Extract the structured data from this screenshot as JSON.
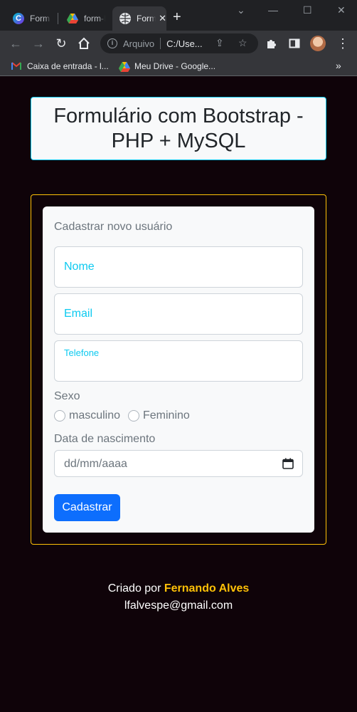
{
  "browser": {
    "tabs": [
      {
        "label": "Form B",
        "icon": "canva-icon"
      },
      {
        "label": "form-L",
        "icon": "google-drive-icon"
      },
      {
        "label": "Form",
        "icon": "globe-icon",
        "active": true
      }
    ],
    "omnibox": {
      "security_label": "Arquivo",
      "url": "C:/Use..."
    },
    "bookmarks": [
      {
        "label": "Caixa de entrada - l...",
        "icon": "gmail-icon"
      },
      {
        "label": "Meu Drive - Google...",
        "icon": "google-drive-icon"
      }
    ],
    "bookmarks_more": "»"
  },
  "page": {
    "title": "Formulário com Bootstrap - PHP + MySQL",
    "form": {
      "legend": "Cadastrar novo usuário",
      "fields": {
        "nome_placeholder": "Nome",
        "email_placeholder": "Email",
        "telefone_placeholder": "Telefone"
      },
      "sexo_label": "Sexo",
      "sexo_options": [
        "masculino",
        "Feminino"
      ],
      "birth_label": "Data de nascimento",
      "birth_value": "dd/mm/aaaa",
      "submit_label": "Cadastrar"
    },
    "footer": {
      "created_by": "Criado por",
      "author": "Fernando Alves",
      "email": "lfalvespe@gmail.com"
    }
  },
  "colors": {
    "background": "#0f0309",
    "accent_cyan": "#0dcaf0",
    "accent_yellow": "#ffc107",
    "button_blue": "#0d6efd"
  }
}
